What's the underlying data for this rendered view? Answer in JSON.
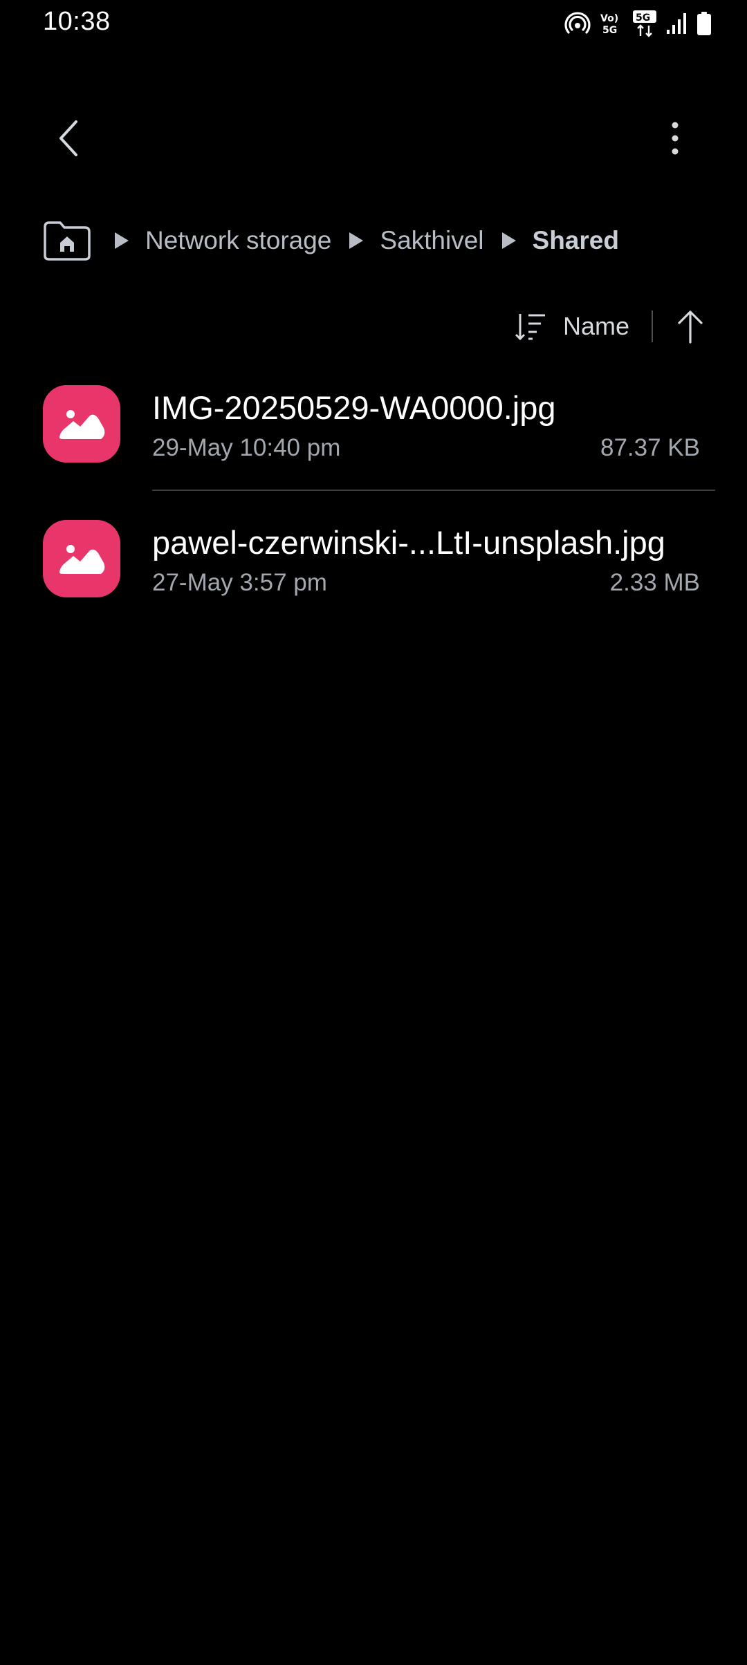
{
  "status_bar": {
    "time": "10:38",
    "icons": [
      "hotspot-icon",
      "volte-icon",
      "5g-icon",
      "signal-icon",
      "battery-icon"
    ],
    "volte_label": "Vo)) 5G",
    "network_label": "5G"
  },
  "app_bar": {
    "back_icon": "chevron-left-icon",
    "more_icon": "more-vertical-icon"
  },
  "breadcrumb": {
    "home_icon": "home-folder-icon",
    "items": [
      "Network storage",
      "Sakthivel",
      "Shared"
    ]
  },
  "sort": {
    "label": "Name",
    "sort_icon": "sort-icon",
    "direction_icon": "arrow-up-icon"
  },
  "files": [
    {
      "name": "IMG-20250529-WA0000.jpg",
      "date": "29-May 10:40 pm",
      "size": "87.37 KB",
      "icon": "image-icon"
    },
    {
      "name": "pawel-czerwinski-...LtI-unsplash.jpg",
      "date": "27-May 3:57 pm",
      "size": "2.33 MB",
      "icon": "image-icon"
    }
  ],
  "colors": {
    "background": "#000000",
    "thumb_accent": "#e8366a",
    "secondary_text": "#a3a7ae"
  }
}
